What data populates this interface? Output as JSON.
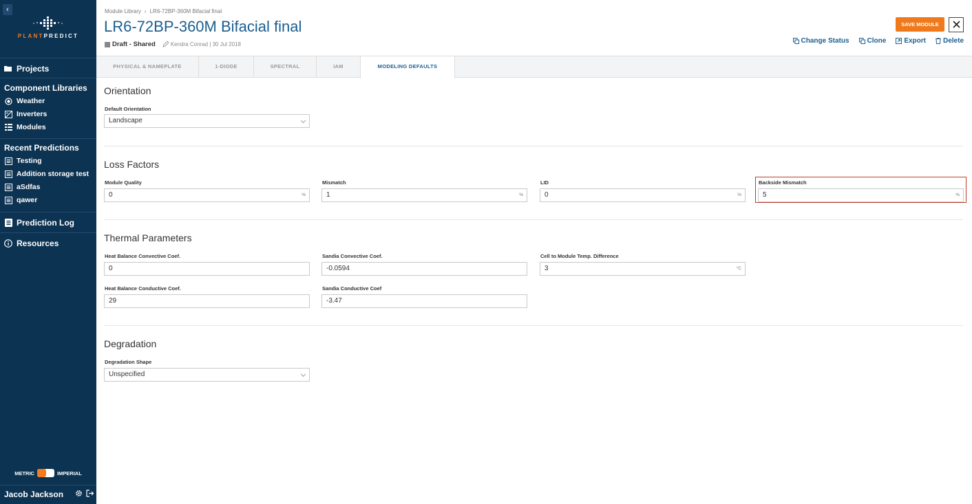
{
  "sidebar": {
    "collapse_glyph": "‹",
    "brand_plant": "PLANT",
    "brand_predict": "PREDICT",
    "projects": "Projects",
    "component_libraries": "Component Libraries",
    "libraries": [
      {
        "label": "Weather",
        "icon": "weather-icon"
      },
      {
        "label": "Inverters",
        "icon": "inverter-icon"
      },
      {
        "label": "Modules",
        "icon": "modules-icon"
      }
    ],
    "recent_predictions_heading": "Recent Predictions",
    "recent_predictions": [
      "Testing",
      "Addition storage test",
      "aSdfas",
      "qawer"
    ],
    "prediction_log": "Prediction Log",
    "resources": "Resources",
    "units_metric": "METRIC",
    "units_imperial": "IMPERIAL",
    "user_name": "Jacob Jackson"
  },
  "header": {
    "breadcrumb_root": "Module Library",
    "breadcrumb_current": "LR6-72BP-360M Bifacial final",
    "title": "LR6-72BP-360M Bifacial final",
    "status": "Draft - Shared",
    "author": "Kendra Conrad | 30 Jul 2018",
    "save_label": "SAVE MODULE",
    "actions": {
      "change_status": "Change Status",
      "clone": "Clone",
      "export": "Export",
      "delete": "Delete"
    }
  },
  "tabs": [
    "PHYSICAL & NAMEPLATE",
    "1-DIODE",
    "SPECTRAL",
    "IAM",
    "MODELING DEFAULTS"
  ],
  "active_tab": "MODELING DEFAULTS",
  "orientation": {
    "title": "Orientation",
    "default_label": "Default Orientation",
    "default_value": "Landscape"
  },
  "loss_factors": {
    "title": "Loss Factors",
    "module_quality_label": "Module Quality",
    "module_quality_value": "0",
    "module_quality_unit": "%",
    "mismatch_label": "Mismatch",
    "mismatch_value": "1",
    "mismatch_unit": "%",
    "lid_label": "LID",
    "lid_value": "0",
    "lid_unit": "%",
    "backside_label": "Backside Mismatch",
    "backside_value": "5",
    "backside_unit": "%"
  },
  "thermal": {
    "title": "Thermal Parameters",
    "hb_convective_label": "Heat Balance Convective Coef.",
    "hb_convective_value": "0",
    "sandia_convective_label": "Sandia Convective Coef.",
    "sandia_convective_value": "-0.0594",
    "cell_temp_label": "Cell to Module Temp. Difference",
    "cell_temp_value": "3",
    "cell_temp_unit": "°C",
    "hb_conductive_label": "Heat Balance Conductive Coef.",
    "hb_conductive_value": "29",
    "sandia_conductive_label": "Sandia Conductive Coef",
    "sandia_conductive_value": "-3.47"
  },
  "degradation": {
    "title": "Degradation",
    "shape_label": "Degradation Shape",
    "shape_value": "Unspecified"
  },
  "colors": {
    "sidebar_bg": "#0d3352",
    "accent_orange": "#f07a1b",
    "title_blue": "#1b5e8f",
    "highlight_red": "#c0392b"
  }
}
